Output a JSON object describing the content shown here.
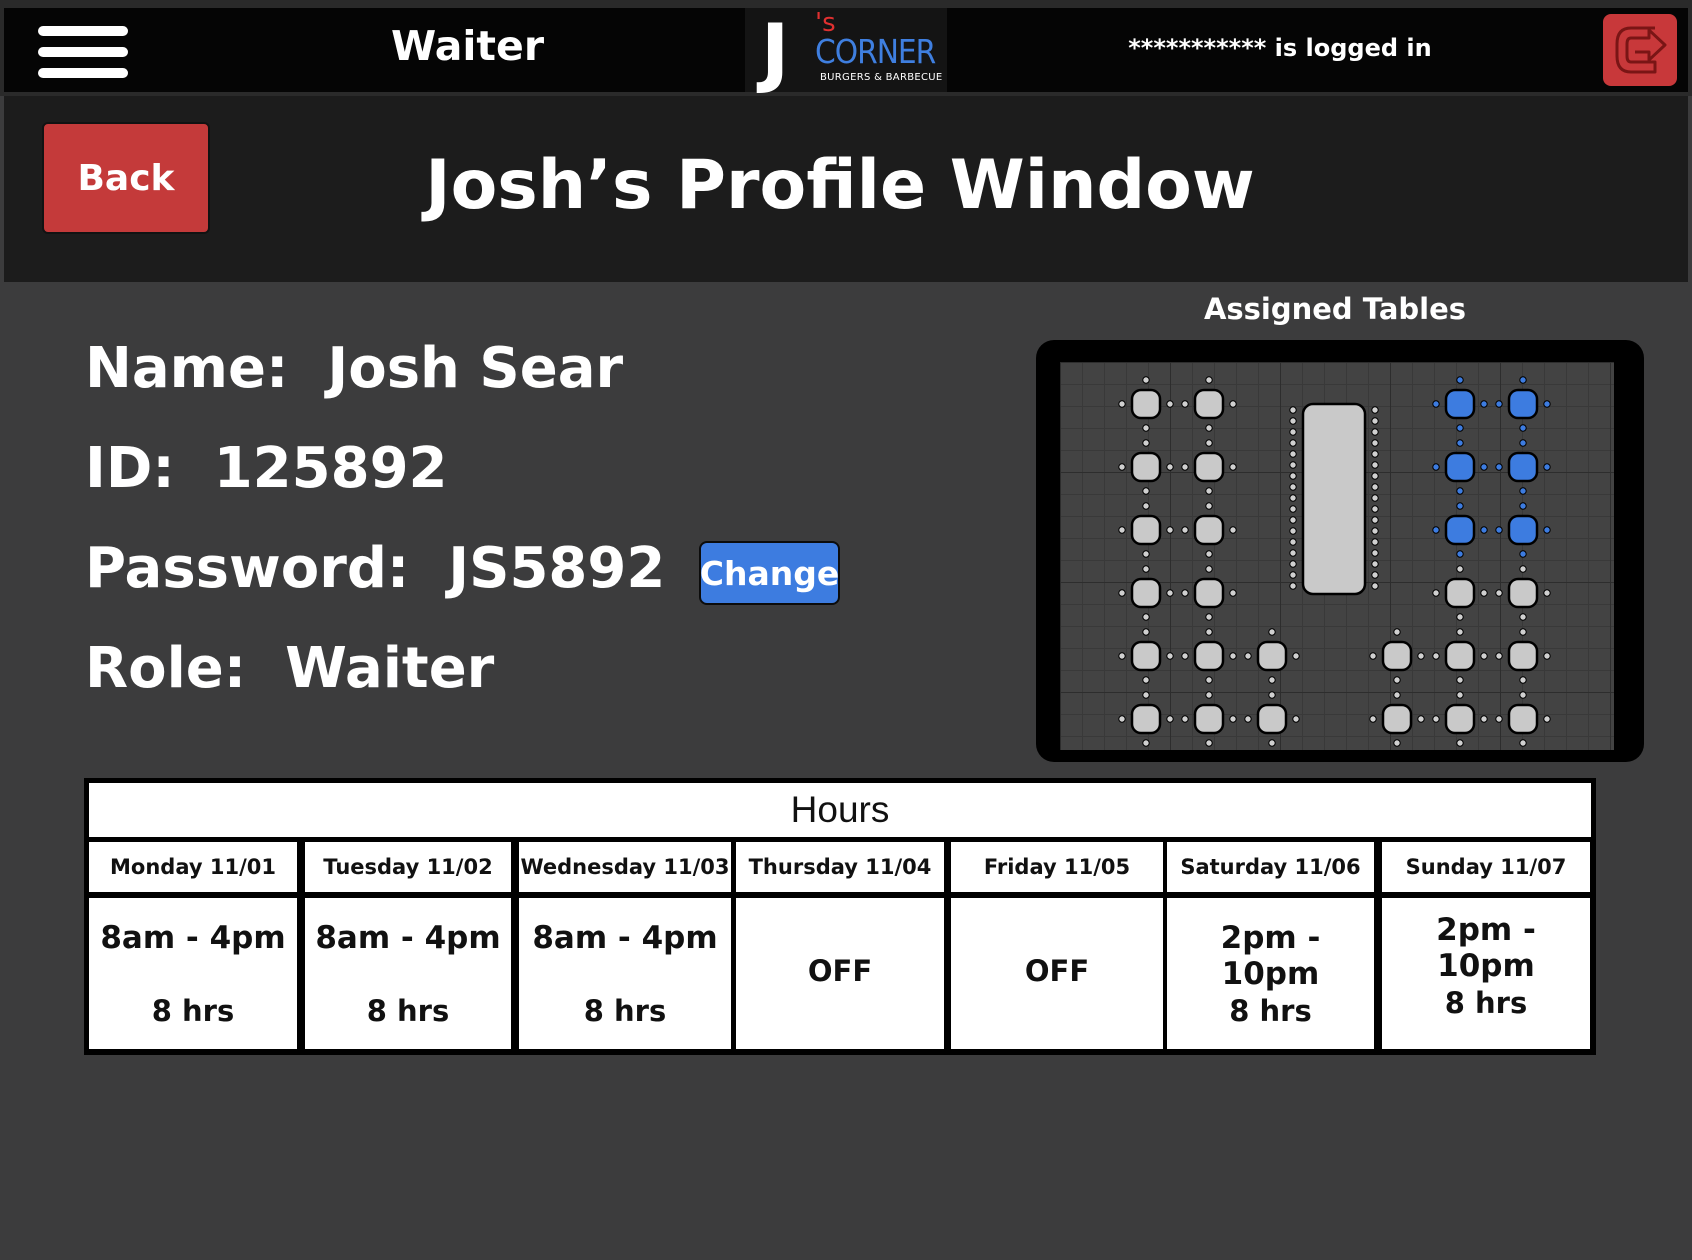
{
  "topbar": {
    "role_title": "Waiter",
    "logo": {
      "letter": "J",
      "superscript": "'s",
      "name": "CORNER",
      "tagline": "BURGERS & BARBECUE"
    },
    "logged_in_text": "*********** is logged in",
    "menu_icon": "hamburger-menu-icon",
    "logout_icon": "logout-arrow-icon"
  },
  "header": {
    "back_label": "Back",
    "page_title": "Josh’s Profile Window"
  },
  "profile": {
    "name_label": "Name:",
    "name_value": "Josh Sear",
    "id_label": "ID:",
    "id_value": "125892",
    "password_label": "Password:",
    "password_value": "JS5892",
    "change_label": "Change",
    "role_label": "Role:",
    "role_value": "Waiter"
  },
  "assigned_tables": {
    "label": "Assigned Tables",
    "assigned_color": "#3d7ce0",
    "unassigned_color": "#c9c9c9",
    "assigned_count": 6
  },
  "hours": {
    "title": "Hours",
    "days": [
      {
        "label": "Monday 11/01",
        "shift": "8am - 4pm",
        "hours": "8 hrs"
      },
      {
        "label": "Tuesday 11/02",
        "shift": "8am - 4pm",
        "hours": "8 hrs"
      },
      {
        "label": "Wednesday 11/03",
        "shift": "8am - 4pm",
        "hours": "8 hrs"
      },
      {
        "label": "Thursday 11/04",
        "off": "OFF"
      },
      {
        "label": "Friday 11/05",
        "off": "OFF"
      },
      {
        "label": "Saturday 11/06",
        "shift": "2pm - 10pm",
        "hours": "8 hrs"
      },
      {
        "label": "Sunday 11/07",
        "shift": "2pm - 10pm",
        "hours": "8 hrs"
      }
    ]
  },
  "colors": {
    "background": "#3c3c3d",
    "header": "#1c1c1c",
    "topbar": "#050505",
    "danger": "#c43a3a",
    "accent": "#3d7ce0"
  }
}
